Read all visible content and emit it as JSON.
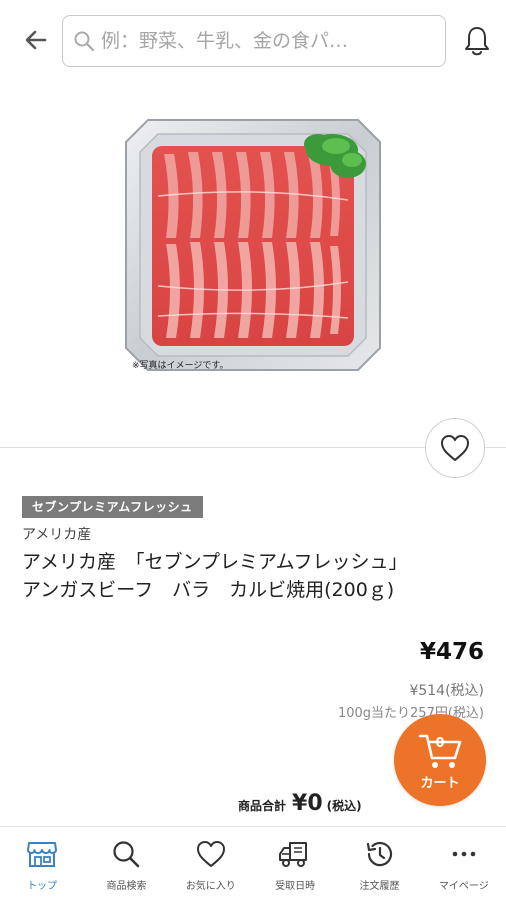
{
  "header": {
    "search_placeholder": "例：野菜、牛乳、金の食パ…"
  },
  "product": {
    "image_caption": "※写真はイメージです。",
    "brand": "セブンプレミアムフレッシュ",
    "origin": "アメリカ産",
    "title_line1": "アメリカ産　「セブンプレミアムフレッシュ」",
    "title_line2": "アンガスビーフ　バラ　カルビ焼用(200ｇ)",
    "price": "¥476",
    "price_tax_incl": "¥514(税込)",
    "unit_price": "100g当たり257円(税込)"
  },
  "total": {
    "label": "商品合計",
    "value": "¥0",
    "tax_note": "(税込)"
  },
  "cart": {
    "count": "0",
    "label": "カート",
    "color": "#ec7328"
  },
  "nav": {
    "items": [
      {
        "label": "トップ",
        "icon": "store-icon"
      },
      {
        "label": "商品検索",
        "icon": "search-icon"
      },
      {
        "label": "お気に入り",
        "icon": "heart-icon"
      },
      {
        "label": "受取日時",
        "icon": "truck-icon"
      },
      {
        "label": "注文履歴",
        "icon": "history-icon"
      },
      {
        "label": "マイページ",
        "icon": "more-icon"
      }
    ],
    "active_color": "#3b82c4"
  }
}
